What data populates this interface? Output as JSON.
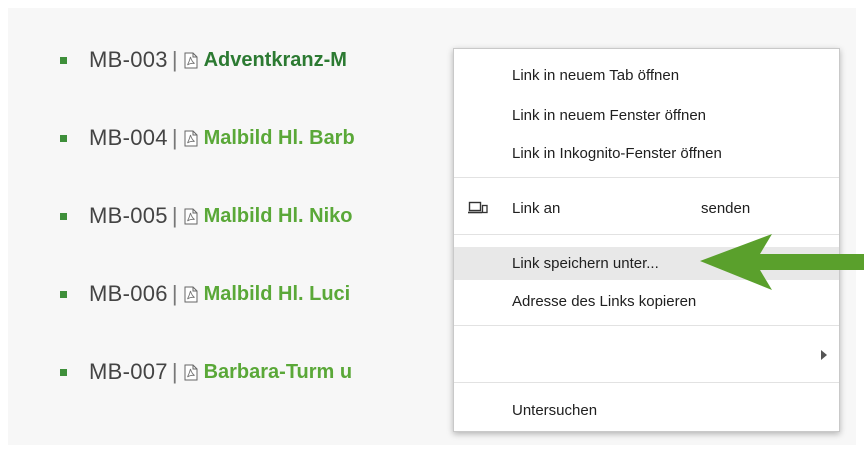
{
  "colors": {
    "bullet": "#3e8f3a",
    "link_green": "#5aa838",
    "link_visited": "#2c7a32",
    "annotation_arrow": "#5aa02c",
    "menu_highlight": "#e8e8e8"
  },
  "downloads": [
    {
      "code": "MB-003",
      "separator": "|",
      "icon": "pdf-file-icon",
      "title": "Adventkranz-M",
      "visited": true
    },
    {
      "code": "MB-004",
      "separator": "|",
      "icon": "pdf-file-icon",
      "title": "Malbild Hl. Barb",
      "visited": false
    },
    {
      "code": "MB-005",
      "separator": "|",
      "icon": "pdf-file-icon",
      "title": "Malbild Hl. Niko",
      "visited": false
    },
    {
      "code": "MB-006",
      "separator": "|",
      "icon": "pdf-file-icon",
      "title": "Malbild Hl. Luci",
      "visited": false
    },
    {
      "code": "MB-007",
      "separator": "|",
      "icon": "pdf-file-icon",
      "title": "Barbara-Turm u",
      "visited": false
    }
  ],
  "context_menu": {
    "open_new_tab": "Link in neuem Tab öffnen",
    "open_new_window": "Link in neuem Fenster öffnen",
    "open_incognito": "Link in Inkognito-Fenster öffnen",
    "send_link_prefix": "Link an",
    "send_link_suffix": "senden",
    "send_link_icon": "devices-icon",
    "save_link_as": "Link speichern unter...",
    "copy_link_address": "Adresse des Links kopieren",
    "submenu_label": "",
    "submenu_icon": "chevron-right-icon",
    "inspect": "Untersuchen",
    "highlighted_item": "save_link_as"
  },
  "annotation": {
    "icon": "left-arrow-icon",
    "points_to": "save_link_as"
  }
}
